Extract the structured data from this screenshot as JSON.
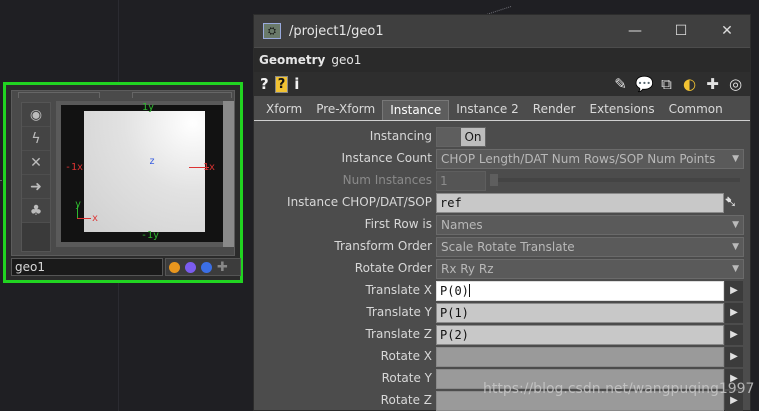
{
  "network": {
    "node": {
      "name": "geo1",
      "viewport": {
        "axis_labels": {
          "top": "1y",
          "bottom": "-1y",
          "left": "-1x",
          "right": "1x",
          "center": "z",
          "gizmo_y": "y",
          "gizmo_x": "x"
        }
      },
      "side_buttons": [
        "target-icon",
        "pulse-icon",
        "cross-icon",
        "arrow-right-icon",
        "sprout-icon"
      ],
      "flag_colors": [
        "#e8961e",
        "#7b5cf0",
        "#3b6fe6"
      ]
    }
  },
  "window": {
    "title": "/project1/geo1",
    "controls": {
      "minimize": "—",
      "maximize": "☐",
      "close": "✕"
    }
  },
  "header": {
    "op_type": "Geometry",
    "op_name": "geo1"
  },
  "toolbar": {
    "left": {
      "help": "?",
      "op_help": "?",
      "info": "i"
    },
    "right_icons": [
      "pencil-icon",
      "comment-icon",
      "clone-icon",
      "python-icon",
      "plus-icon",
      "target-icon"
    ]
  },
  "tabs": [
    {
      "label": "Xform",
      "active": false
    },
    {
      "label": "Pre-Xform",
      "active": false
    },
    {
      "label": "Instance",
      "active": true
    },
    {
      "label": "Instance 2",
      "active": false
    },
    {
      "label": "Render",
      "active": false
    },
    {
      "label": "Extensions",
      "active": false
    },
    {
      "label": "Common",
      "active": false
    }
  ],
  "params": {
    "instancing": {
      "label": "Instancing",
      "value": "On"
    },
    "instance_count": {
      "label": "Instance Count",
      "value": "CHOP Length/DAT Num Rows/SOP Num Points"
    },
    "num_instances": {
      "label": "Num Instances",
      "value": "1"
    },
    "instance_op": {
      "label": "Instance CHOP/DAT/SOP",
      "value": "ref"
    },
    "first_row_is": {
      "label": "First Row is",
      "value": "Names"
    },
    "transform_order": {
      "label": "Transform Order",
      "value": "Scale Rotate Translate"
    },
    "rotate_order": {
      "label": "Rotate Order",
      "value": "Rx Ry Rz"
    },
    "translate_x": {
      "label": "Translate X",
      "value": "P(0)"
    },
    "translate_y": {
      "label": "Translate Y",
      "value": "P(1)"
    },
    "translate_z": {
      "label": "Translate Z",
      "value": "P(2)"
    },
    "rotate_x": {
      "label": "Rotate X",
      "value": ""
    },
    "rotate_y": {
      "label": "Rotate Y",
      "value": ""
    },
    "rotate_z": {
      "label": "Rotate Z",
      "value": ""
    }
  },
  "watermark": "https://blog.csdn.net/wangpuqing1997"
}
